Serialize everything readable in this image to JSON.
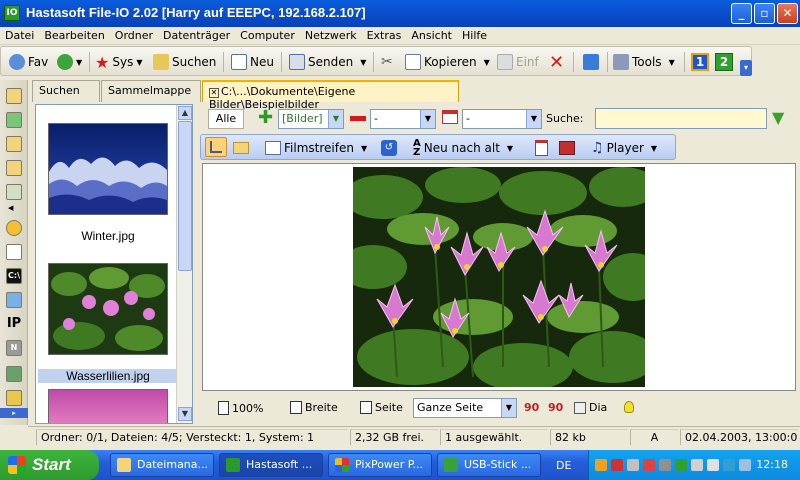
{
  "window": {
    "app_icon_label": "IO",
    "title": "Hastasoft File-IO 2.02  [Harry auf EEEPC, 192.168.2.107]"
  },
  "menu": [
    "Datei",
    "Bearbeiten",
    "Ordner",
    "Datenträger",
    "Computer",
    "Netzwerk",
    "Extras",
    "Ansicht",
    "Hilfe"
  ],
  "toolbar": {
    "fav": "Fav",
    "sys": "Sys",
    "suchen": "Suchen",
    "neu": "Neu",
    "senden": "Senden",
    "kopieren": "Kopieren",
    "einf": "Einf",
    "tools": "Tools",
    "view1": "1",
    "view2": "2"
  },
  "left_icons": [
    "folder-icon",
    "refresh-icon",
    "copy-icon",
    "folder-open-icon",
    "drive-icon",
    "add-icon",
    "window-icon",
    "console-icon",
    "windows-icon",
    "ip-icon",
    "notes-icon",
    "network-icon",
    "export-icon"
  ],
  "left_labels": {
    "cmd": "C:\\",
    "ip": "IP",
    "notes": "N"
  },
  "tabs": {
    "suchen": "Suchen",
    "sammelmappe": "Sammelmappe",
    "path": "C:\\...\\Dokumente\\Eigene Bilder\\Beispielbilder"
  },
  "thumbnails": [
    {
      "caption": "Winter.jpg"
    },
    {
      "caption": "Wasserlilien.jpg"
    }
  ],
  "filter": {
    "alle": "Alle",
    "include_value": "[Bilder]",
    "exclude_value": "-",
    "date_value": "-",
    "suche_label": "Suche:",
    "suche_value": ""
  },
  "viewbar": {
    "mode": "Filmstreifen",
    "sort": "Neu nach alt",
    "player": "Player"
  },
  "zoombar": {
    "zoom": "100%",
    "breite": "Breite",
    "seite": "Seite",
    "fit": "Ganze Seite",
    "rot_left": "90",
    "rot_right": "90",
    "dia": "Dia"
  },
  "status": {
    "folders": "Ordner: 0/1, Dateien: 4/5; Versteckt: 1, System: 1",
    "free": "2,32 GB frei.",
    "selected": "1 ausgewählt.",
    "size": "82 kb",
    "attr": "A",
    "date": "02.04.2003, 13:00:0..."
  },
  "taskbar": {
    "start": "Start",
    "tasks": [
      "Dateimana...",
      "Hastasoft ...",
      "PixPower P...",
      "USB-Stick ..."
    ],
    "lang": "DE",
    "clock": "12:18"
  },
  "colors": {
    "accent": "#0a5fdc",
    "tab_active": "#fff3c6",
    "start_green": "#3cb53c"
  }
}
